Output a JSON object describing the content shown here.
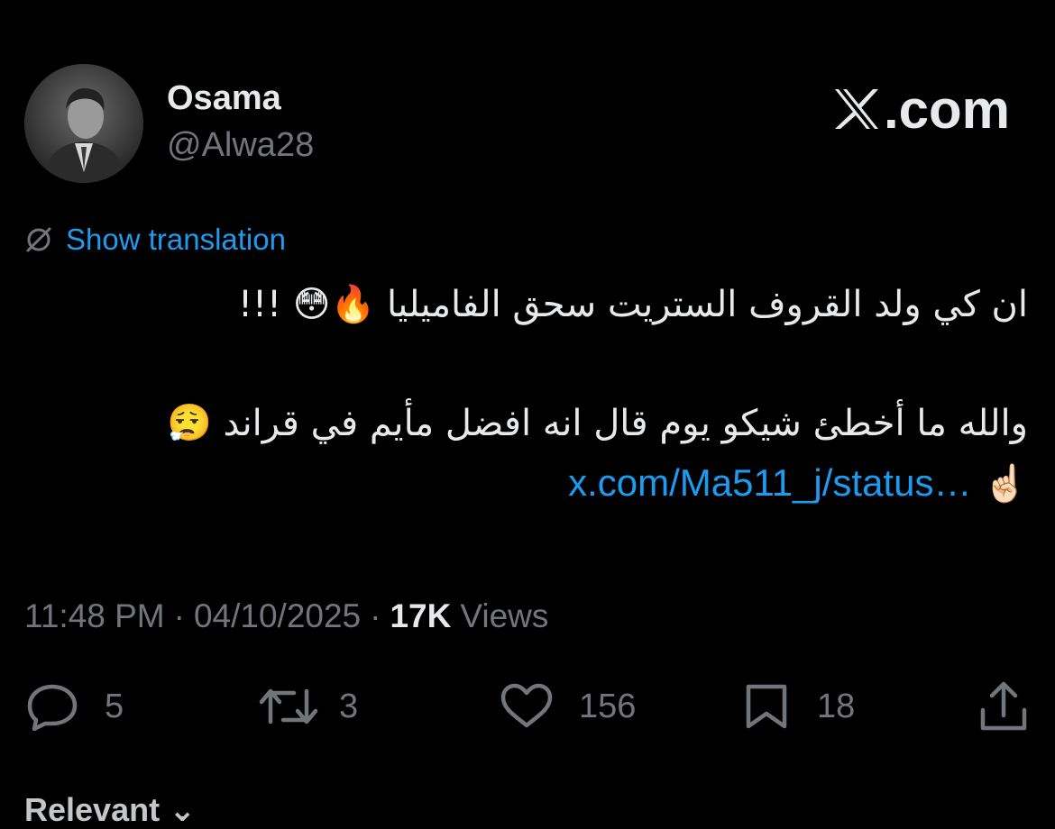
{
  "author": {
    "display_name": "Osama",
    "handle": "@Alwa28"
  },
  "brand": {
    "logo_icon": "x-logo-icon",
    "domain_label": ".com"
  },
  "translation": {
    "icon": "globe-slash-icon",
    "label": "Show translation"
  },
  "tweet": {
    "line1": "ان كي ولد القروف الستريت سحق الفاميليا 🔥😳 !!!",
    "line2": "والله ما أخطئ شيكو يوم قال انه افضل مأيم في قراند 😮‍💨",
    "pointing_emoji": "☝🏻",
    "link_text": "x.com/Ma511_j/status…"
  },
  "meta": {
    "time": "11:48 PM",
    "separator": "·",
    "date": "04/10/2025",
    "views_count": "17K",
    "views_label": "Views"
  },
  "actions": {
    "replies": "5",
    "reposts": "3",
    "likes": "156",
    "bookmarks": "18",
    "icons": [
      "reply-icon",
      "repost-icon",
      "like-icon",
      "bookmark-icon",
      "share-icon"
    ]
  },
  "section": {
    "relevant_label": "Relevant ⌄"
  },
  "colors": {
    "background": "#000000",
    "text_primary": "#e7e9ea",
    "text_secondary": "#71767b",
    "accent": "#1d9bf0"
  }
}
